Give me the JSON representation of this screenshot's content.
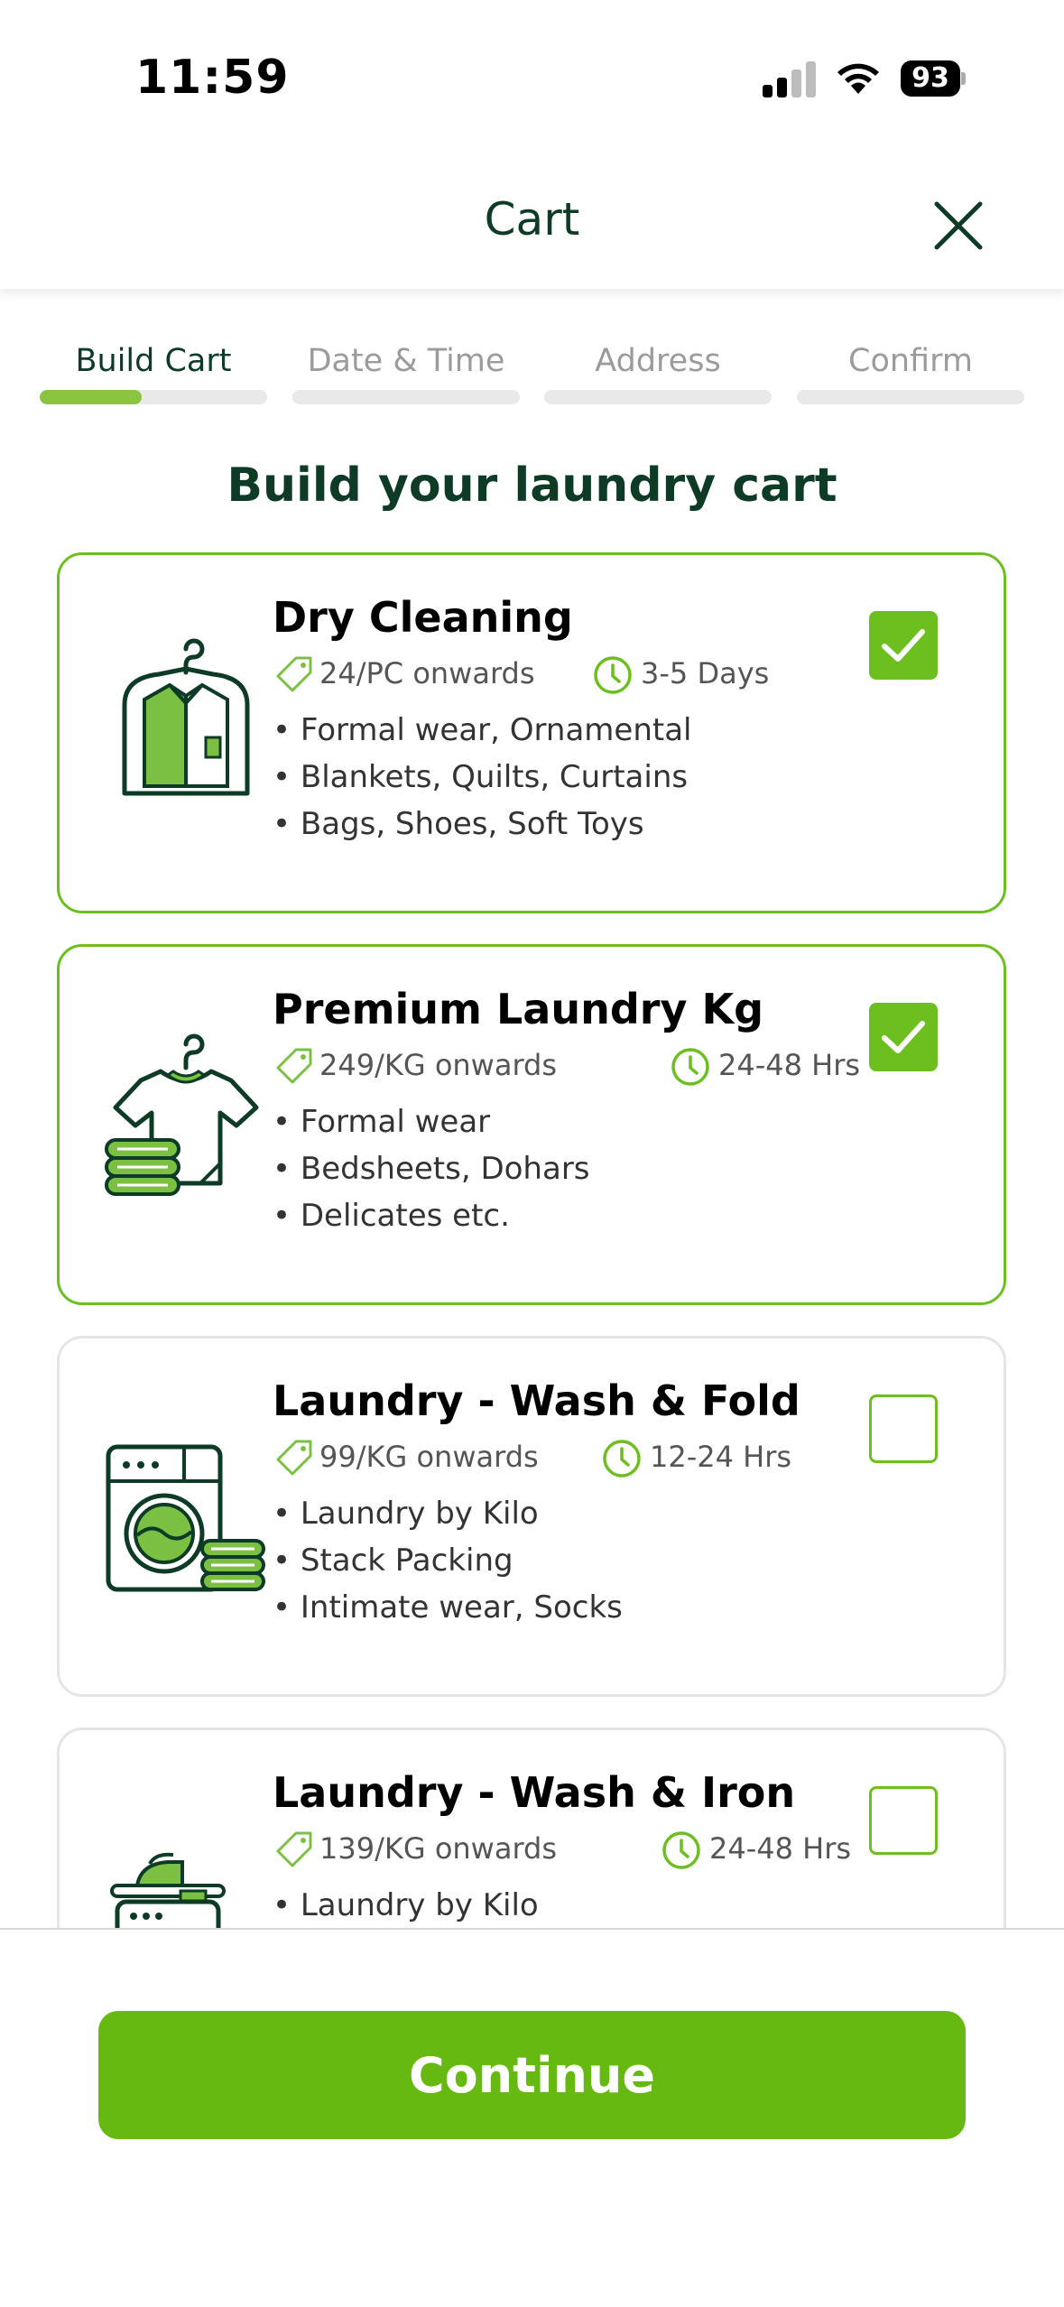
{
  "status_bar": {
    "time": "11:59",
    "battery": "93"
  },
  "header": {
    "title": "Cart"
  },
  "steps": [
    {
      "label": "Build Cart",
      "active": true,
      "progress": 0.45
    },
    {
      "label": "Date & Time",
      "active": false,
      "progress": 0
    },
    {
      "label": "Address",
      "active": false,
      "progress": 0
    },
    {
      "label": "Confirm",
      "active": false,
      "progress": 0
    }
  ],
  "page_title": "Build your laundry cart",
  "services": [
    {
      "title": "Dry Cleaning",
      "price": "24/PC onwards",
      "eta": "3-5 Days",
      "features": [
        "• Formal wear, Ornamental",
        "• Blankets, Quilts, Curtains",
        "• Bags, Shoes, Soft Toys"
      ],
      "selected": true,
      "icon": "jacket-on-hanger-icon"
    },
    {
      "title": "Premium Laundry Kg",
      "price": "249/KG onwards",
      "eta": "24-48 Hrs",
      "features": [
        "• Formal wear",
        "• Bedsheets, Dohars",
        "• Delicates etc."
      ],
      "selected": true,
      "icon": "tshirt-stack-icon"
    },
    {
      "title": "Laundry - Wash & Fold",
      "price": "99/KG onwards",
      "eta": "12-24 Hrs",
      "features": [
        "• Laundry by Kilo",
        "• Stack Packing",
        "• Intimate wear, Socks"
      ],
      "selected": false,
      "icon": "washing-machine-icon"
    },
    {
      "title": "Laundry - Wash & Iron",
      "price": "139/KG onwards",
      "eta": "24-48 Hrs",
      "features": [
        "• Laundry by Kilo"
      ],
      "selected": false,
      "icon": "iron-washer-icon"
    }
  ],
  "footer": {
    "continue_label": "Continue"
  },
  "colors": {
    "accent": "#6cbf1f",
    "button": "#65b911",
    "dark_green": "#0d3b26",
    "progress": "#8bc540"
  }
}
